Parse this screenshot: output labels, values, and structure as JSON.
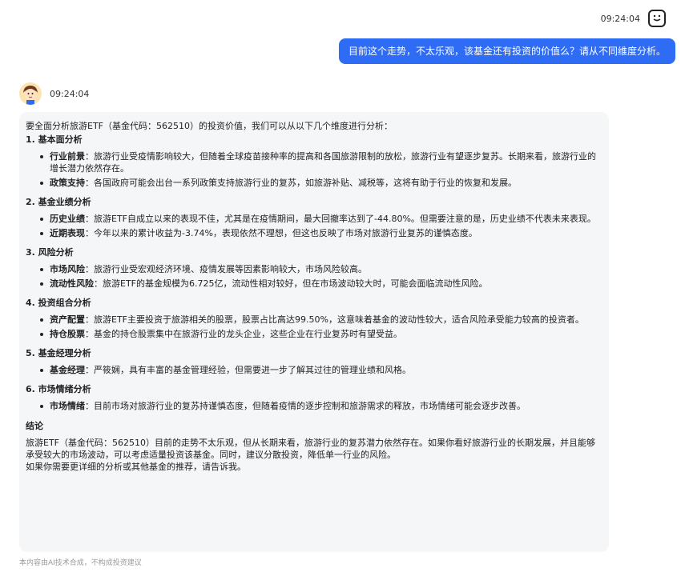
{
  "user": {
    "time": "09:24:04",
    "message": "目前这个走势，不太乐观，该基金还有投资的价值么？请从不同维度分析。"
  },
  "bot": {
    "time": "09:24:04",
    "intro": "要全面分析旅游ETF（基金代码：562510）的投资价值，我们可以从以下几个维度进行分析：",
    "sections": [
      {
        "title": "1. 基本面分析",
        "items": [
          {
            "label": "行业前景",
            "text": "：旅游行业受疫情影响较大，但随着全球疫苗接种率的提高和各国旅游限制的放松，旅游行业有望逐步复苏。长期来看，旅游行业的增长潜力依然存在。"
          },
          {
            "label": "政策支持",
            "text": "：各国政府可能会出台一系列政策支持旅游行业的复苏，如旅游补贴、减税等，这将有助于行业的恢复和发展。"
          }
        ]
      },
      {
        "title": "2. 基金业绩分析",
        "items": [
          {
            "label": "历史业绩",
            "text": "：旅游ETF自成立以来的表现不佳，尤其是在疫情期间，最大回撤率达到了-44.80%。但需要注意的是，历史业绩不代表未来表现。"
          },
          {
            "label": "近期表现",
            "text": "：今年以来的累计收益为-3.74%，表现依然不理想，但这也反映了市场对旅游行业复苏的谨慎态度。"
          }
        ]
      },
      {
        "title": "3. 风险分析",
        "items": [
          {
            "label": "市场风险",
            "text": "：旅游行业受宏观经济环境、疫情发展等因素影响较大，市场风险较高。"
          },
          {
            "label": "流动性风险",
            "text": "：旅游ETF的基金规模为6.725亿，流动性相对较好，但在市场波动较大时，可能会面临流动性风险。"
          }
        ]
      },
      {
        "title": "4. 投资组合分析",
        "items": [
          {
            "label": "资产配置",
            "text": "：旅游ETF主要投资于旅游相关的股票，股票占比高达99.50%，这意味着基金的波动性较大，适合风险承受能力较高的投资者。"
          },
          {
            "label": "持仓股票",
            "text": "：基金的持仓股票集中在旅游行业的龙头企业，这些企业在行业复苏时有望受益。"
          }
        ]
      },
      {
        "title": "5. 基金经理分析",
        "items": [
          {
            "label": "基金经理",
            "text": "：严筱娴，具有丰富的基金管理经验，但需要进一步了解其过往的管理业绩和风格。"
          }
        ]
      },
      {
        "title": "6. 市场情绪分析",
        "items": [
          {
            "label": "市场情绪",
            "text": "：目前市场对旅游行业的复苏持谨慎态度，但随着疫情的逐步控制和旅游需求的释放，市场情绪可能会逐步改善。"
          }
        ]
      }
    ],
    "conclusion_title": "结论",
    "conclusion_p1": "旅游ETF（基金代码：562510）目前的走势不太乐观，但从长期来看，旅游行业的复苏潜力依然存在。如果你看好旅游行业的长期发展，并且能够承受较大的市场波动，可以考虑适量投资该基金。同时，建议分散投资，降低单一行业的风险。",
    "conclusion_p2": "如果你需要更详细的分析或其他基金的推荐，请告诉我。"
  },
  "disclaimer": "本内容由AI技术合成，不构成投资建议",
  "colors": {
    "user_bubble": "#2f6cf6",
    "card_bg": "#f5f6f8"
  },
  "icons": {
    "user_avatar": "smiley-chat-icon",
    "bot_avatar": "cartoon-boy-avatar"
  }
}
